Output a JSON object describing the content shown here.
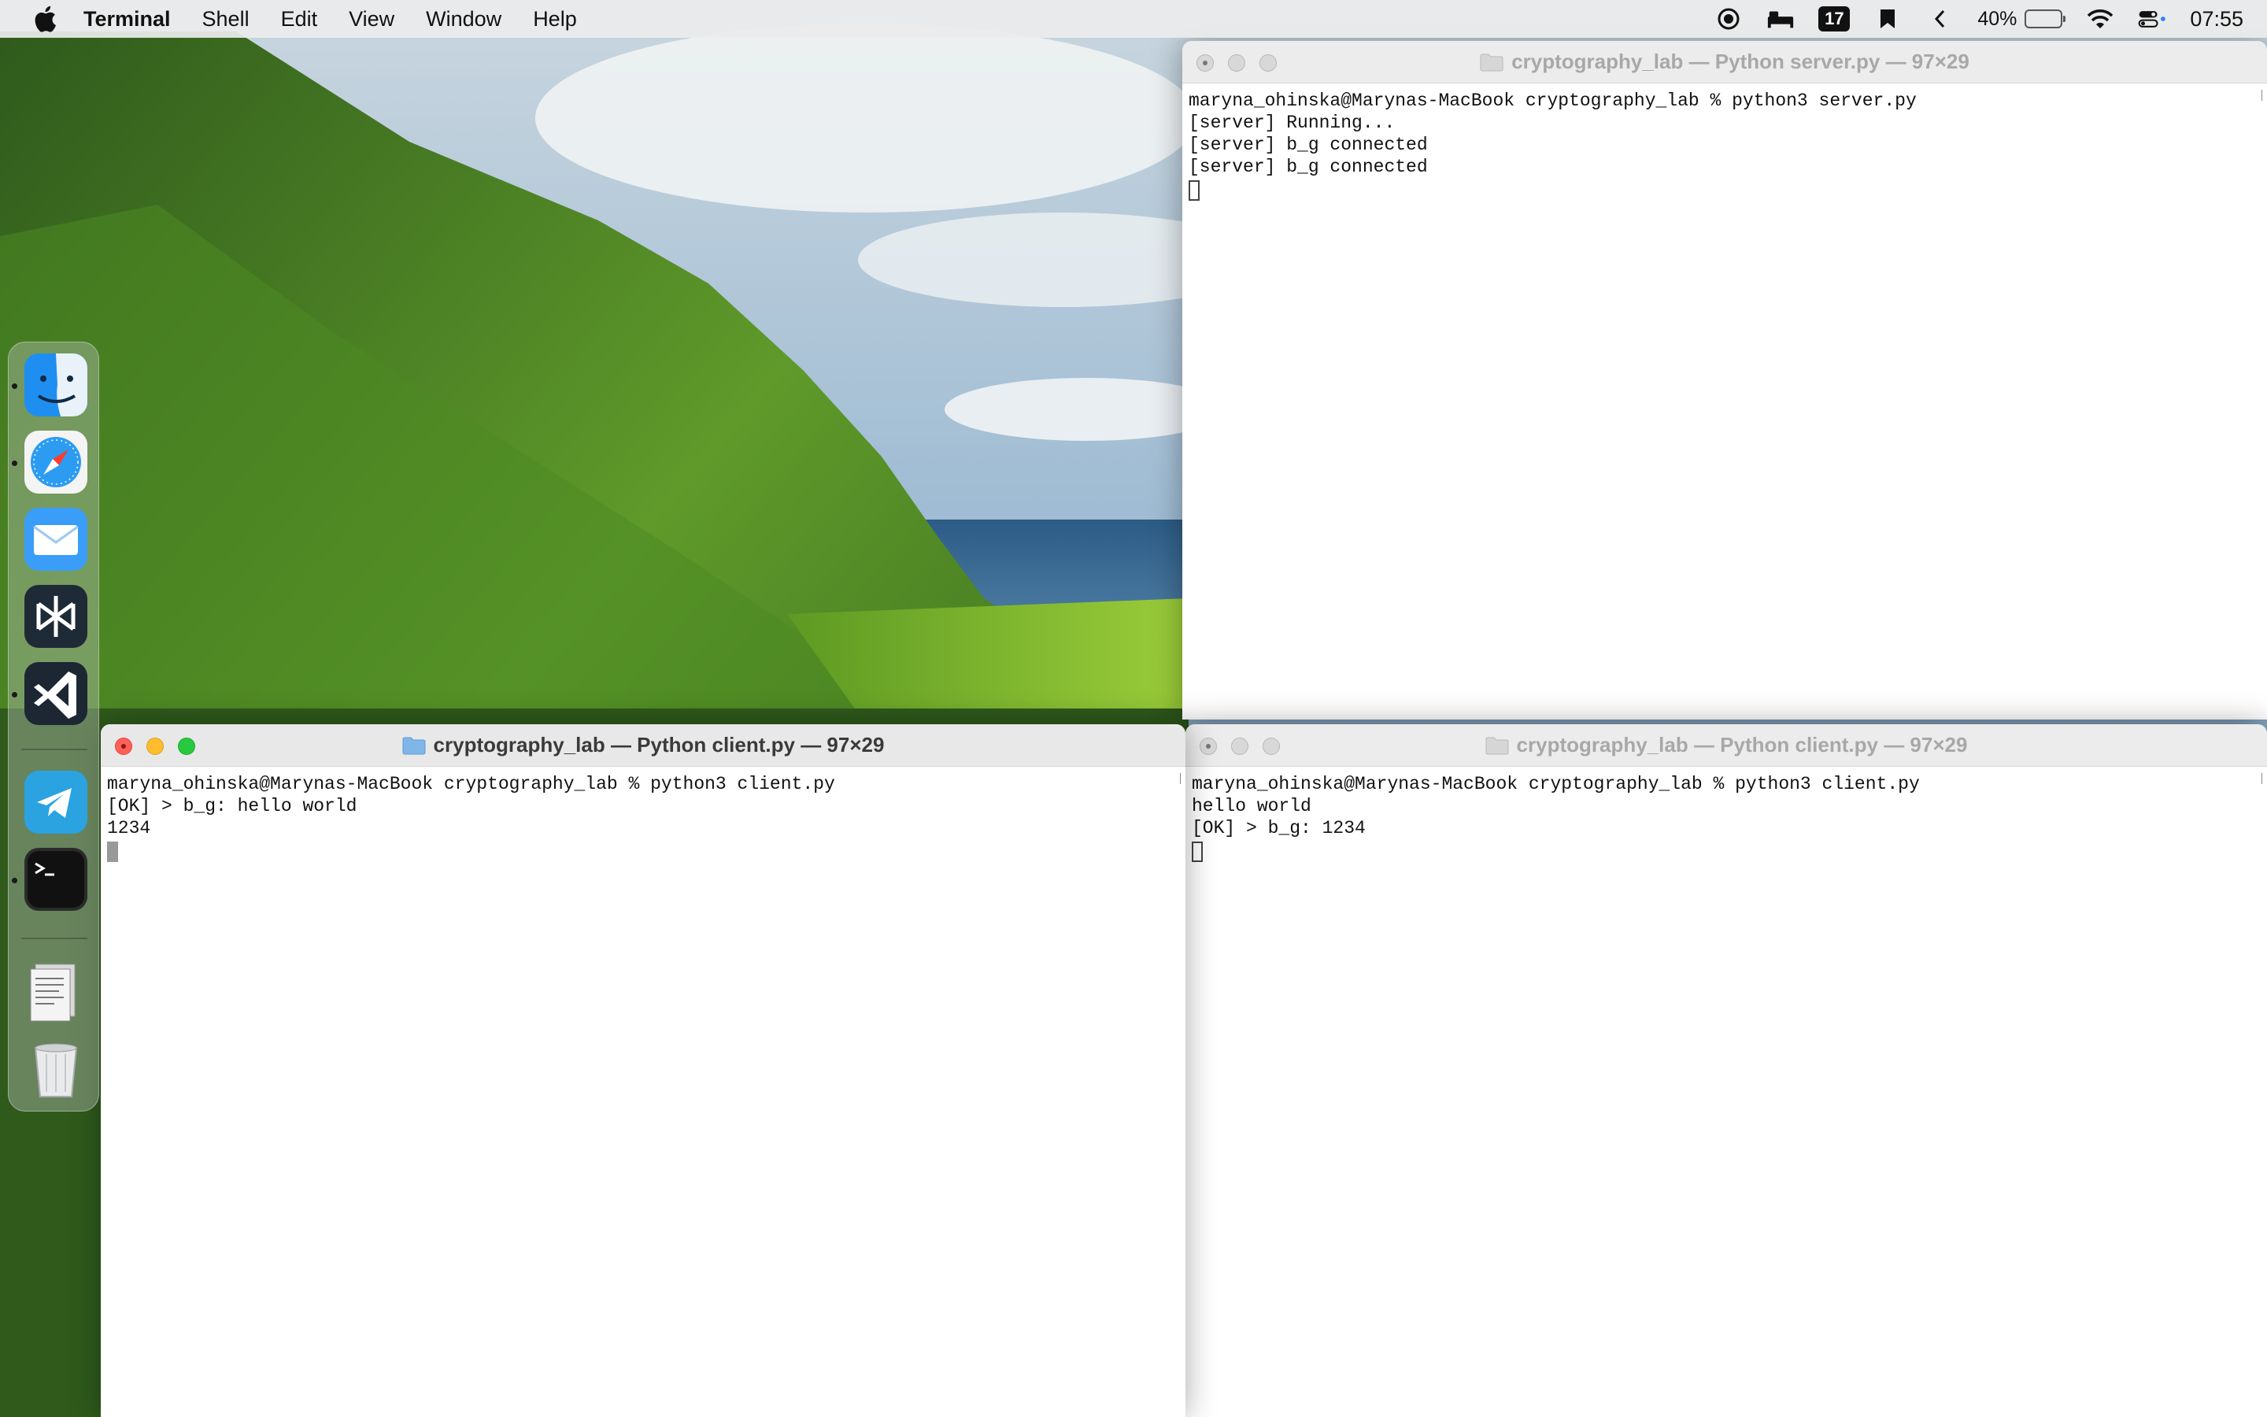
{
  "menubar": {
    "app_name": "Terminal",
    "menus": [
      "Shell",
      "Edit",
      "View",
      "Window",
      "Help"
    ],
    "calendar_badge": "17",
    "battery_percent": "40%",
    "battery_level": 0.4,
    "clock": "07:55"
  },
  "dock": {
    "apps": [
      "finder",
      "safari",
      "mail",
      "perplexity",
      "vscode",
      "telegram",
      "terminal",
      "documents",
      "trash"
    ]
  },
  "windows": {
    "server": {
      "title": "cryptography_lab — Python server.py — 97×29",
      "lines": [
        "maryna_ohinska@Marynas-MacBook cryptography_lab % python3 server.py",
        "[server] Running...",
        "[server] b_g connected",
        "[server] b_g connected"
      ]
    },
    "client_left": {
      "title": "cryptography_lab — Python client.py — 97×29",
      "lines": [
        "maryna_ohinska@Marynas-MacBook cryptography_lab % python3 client.py",
        "[OK] > b_g: hello world",
        "1234"
      ]
    },
    "client_right": {
      "title": "cryptography_lab — Python client.py — 97×29",
      "lines": [
        "maryna_ohinska@Marynas-MacBook cryptography_lab % python3 client.py",
        "hello world",
        "[OK] > b_g: 1234"
      ]
    }
  }
}
